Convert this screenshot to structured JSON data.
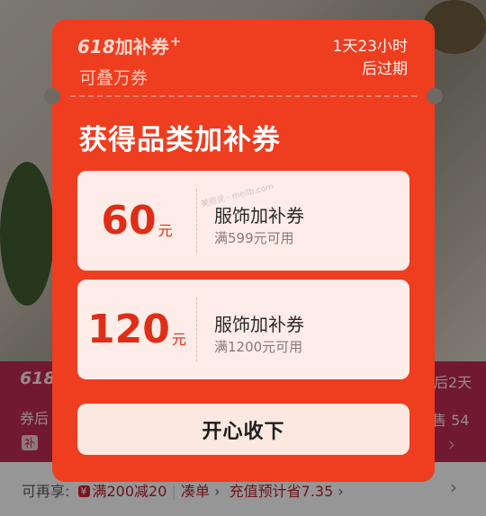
{
  "background": {
    "strip_brand": "618",
    "strip_right_top": "后2天",
    "strip_left_mid": "券后",
    "strip_right_mid": "售 54",
    "strip_tag": "补",
    "promo_label": "可再享:",
    "promo_tag": "¥",
    "promo_offer": "满200减20",
    "promo_bundle": "凑单",
    "promo_recharge": "充值预计省7.35"
  },
  "modal": {
    "brand_number": "618",
    "brand_text": "加补券",
    "brand_plus": "+",
    "stackable": "可叠万券",
    "expire_line1": "1天23小时",
    "expire_line2": "后过期",
    "title": "获得品类加补券",
    "coupons": [
      {
        "amount": "60",
        "unit": "元",
        "name": "服饰加补券",
        "condition": "满599元可用"
      },
      {
        "amount": "120",
        "unit": "元",
        "name": "服饰加补券",
        "condition": "满1200元可用"
      }
    ],
    "watermark": "美丽说 · meilb.com",
    "accept_label": "开心收下"
  },
  "colors": {
    "modal_red": "#ef3d1f",
    "coupon_bg": "#fdece7",
    "amount_red": "#de2e17"
  }
}
